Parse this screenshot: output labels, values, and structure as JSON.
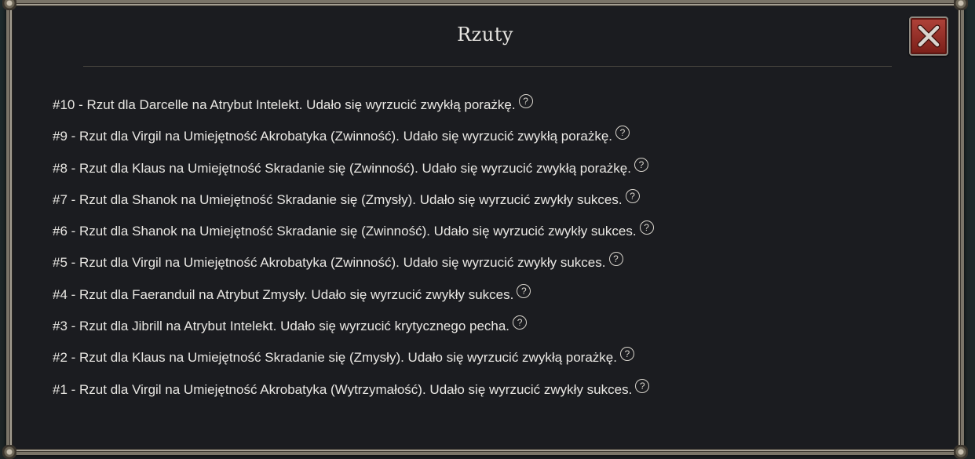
{
  "dialog": {
    "title": "Rzuty",
    "close_icon": "close-x-icon",
    "help_icon_glyph": "?"
  },
  "rolls": [
    {
      "text": "#10 - Rzut dla Darcelle na Atrybut Intelekt. Udało się wyrzucić zwykłą porażkę."
    },
    {
      "text": "#9 - Rzut dla Virgil na Umiejętność Akrobatyka (Zwinność). Udało się wyrzucić zwykłą porażkę."
    },
    {
      "text": "#8 - Rzut dla Klaus na Umiejętność Skradanie się (Zwinność). Udało się wyrzucić zwykłą porażkę."
    },
    {
      "text": "#7 - Rzut dla Shanok na Umiejętność Skradanie się (Zmysły). Udało się wyrzucić zwykły sukces."
    },
    {
      "text": "#6 - Rzut dla Shanok na Umiejętność Skradanie się (Zwinność). Udało się wyrzucić zwykły sukces."
    },
    {
      "text": "#5 - Rzut dla Virgil na Umiejętność Akrobatyka (Zwinność). Udało się wyrzucić zwykły sukces."
    },
    {
      "text": "#4 - Rzut dla Faeranduil na Atrybut Zmysły. Udało się wyrzucić zwykły sukces."
    },
    {
      "text": "#3 - Rzut dla Jibrill na Atrybut Intelekt. Udało się wyrzucić krytycznego pecha."
    },
    {
      "text": "#2 - Rzut dla Klaus na Umiejętność Skradanie się (Zmysły). Udało się wyrzucić zwykłą porażkę."
    },
    {
      "text": "#1 - Rzut dla Virgil na Umiejętność Akrobatyka (Wytrzymałość). Udało się wyrzucić zwykły sukces."
    }
  ]
}
